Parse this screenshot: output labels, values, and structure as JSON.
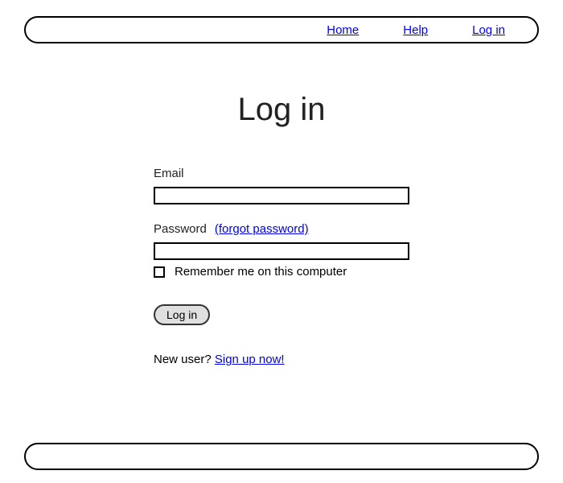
{
  "nav": {
    "home": "Home",
    "help": "Help",
    "login": "Log in"
  },
  "page": {
    "title": "Log in"
  },
  "form": {
    "email_label": "Email",
    "email_value": "",
    "password_label": "Password",
    "forgot_text": "(forgot password)",
    "password_value": "",
    "remember_label": "Remember me on this computer",
    "submit_label": "Log in"
  },
  "signup": {
    "prompt": "New user?  ",
    "link_text": "Sign up now!"
  }
}
